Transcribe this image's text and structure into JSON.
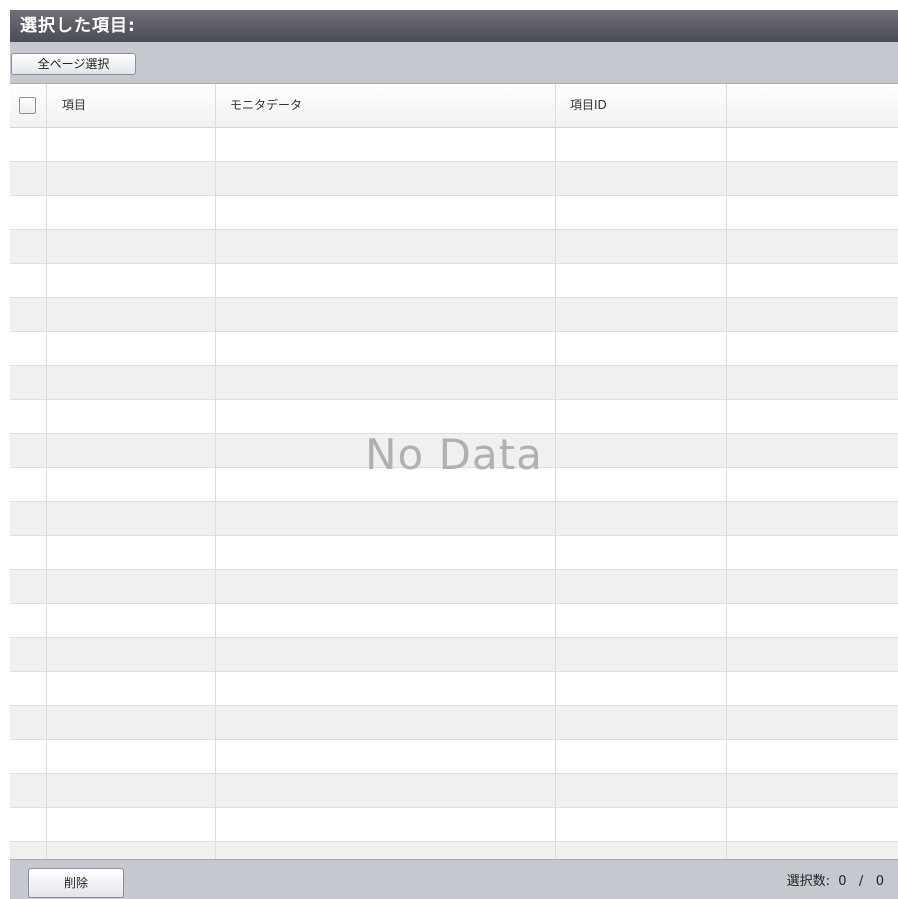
{
  "panel": {
    "title": "選択した項目:"
  },
  "toolbar": {
    "select_all_pages_label": "全ページ選択"
  },
  "table": {
    "columns": [
      {
        "label": ""
      },
      {
        "label": "項目"
      },
      {
        "label": "モニタデータ"
      },
      {
        "label": "項目ID"
      },
      {
        "label": ""
      }
    ],
    "rows": [],
    "empty_message": "No Data"
  },
  "footer": {
    "delete_label": "削除",
    "selection_count_label": "選択数:",
    "selected_count": "0",
    "separator": "/",
    "total_count": "0"
  },
  "colors": {
    "title_bar": "#5a5b63",
    "toolbar": "#c6c8cf",
    "row_alt": "#f0f0f0",
    "empty_text": "#b0b0b0"
  }
}
